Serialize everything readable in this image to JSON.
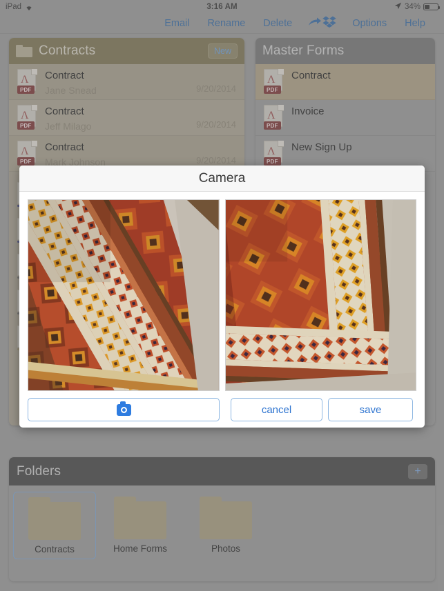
{
  "status_bar": {
    "device": "iPad",
    "wifi_icon": "wifi-icon",
    "time": "3:16 AM",
    "location_icon": "location-arrow-icon",
    "battery_percent": "34%",
    "battery_icon": "battery-icon",
    "battery_level": 34
  },
  "toolbar": {
    "items": [
      {
        "label": "Email",
        "name": "email-button"
      },
      {
        "label": "Rename",
        "name": "rename-button"
      },
      {
        "label": "Delete",
        "name": "delete-button"
      }
    ],
    "share_icon": "share-arrow-icon",
    "dropbox_icon": "dropbox-icon",
    "options_label": "Options",
    "help_label": "Help"
  },
  "contracts_panel": {
    "title": "Contracts",
    "folder_icon": "folder-icon",
    "new_button": "New",
    "files": [
      {
        "name": "Contract",
        "author": "Jane Snead",
        "date": "9/20/2014",
        "type": "PDF"
      },
      {
        "name": "Contract",
        "author": "Jeff Milago",
        "date": "9/20/2014",
        "type": "PDF"
      },
      {
        "name": "Contract",
        "author": "Mark Johnson",
        "date": "9/20/2014",
        "type": "PDF"
      }
    ]
  },
  "master_panel": {
    "title": "Master Forms",
    "files": [
      {
        "name": "Contract",
        "type": "PDF",
        "selected": true
      },
      {
        "name": "Invoice",
        "type": "PDF",
        "selected": false
      },
      {
        "name": "New Sign Up",
        "type": "PDF",
        "selected": false
      }
    ]
  },
  "folders_section": {
    "title": "Folders",
    "add_button": "+",
    "folders": [
      {
        "label": "Contracts",
        "selected": true
      },
      {
        "label": "Home Forms",
        "selected": false
      },
      {
        "label": "Photos",
        "selected": false
      }
    ]
  },
  "camera_modal": {
    "title": "Camera",
    "photos": [
      {
        "name": "photo-preview-left",
        "subject": "kilim rug on concrete floor"
      },
      {
        "name": "photo-preview-right",
        "subject": "kilim rug corner on concrete floor"
      }
    ],
    "capture_icon": "camera-icon",
    "capture_label": "",
    "cancel_label": "cancel",
    "save_label": "save"
  },
  "colors": {
    "accent_blue": "#2e74d0",
    "toolbar_link": "#3c6ea5",
    "contracts_header": "#7f7656",
    "master_header": "#787878",
    "folders_header": "#4b4b4b",
    "pdf_badge": "#7e3b3b",
    "background": "#9a9a9a"
  }
}
